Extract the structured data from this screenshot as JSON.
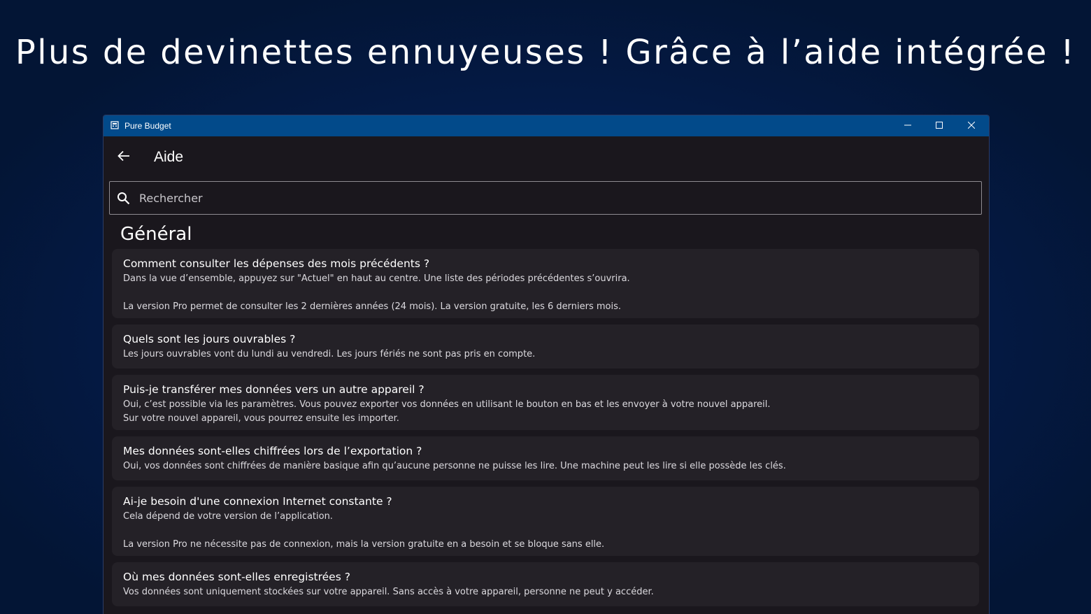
{
  "banner": {
    "headline": "Plus de devinettes ennuyeuses ! Grâce à l’aide intégrée !"
  },
  "window": {
    "title": "Pure Budget",
    "controls": {
      "minimize": "minimize-icon",
      "maximize": "maximize-icon",
      "close": "close-icon"
    }
  },
  "header": {
    "title": "Aide",
    "back_icon": "back-arrow-icon"
  },
  "search": {
    "placeholder": "Rechercher",
    "value": "",
    "icon": "search-icon"
  },
  "section": {
    "title": "Général"
  },
  "faq": [
    {
      "question": "Comment consulter les dépenses des mois précédents ?",
      "answer": "Dans la vue d’ensemble, appuyez sur \"Actuel\" en haut au centre. Une liste des périodes précédentes s’ouvrira.\n\nLa version Pro permet de consulter les 2 dernières années (24 mois). La version gratuite, les 6 derniers mois."
    },
    {
      "question": "Quels sont les jours ouvrables ?",
      "answer": "Les jours ouvrables vont du lundi au vendredi. Les jours fériés ne sont pas pris en compte."
    },
    {
      "question": "Puis-je transférer mes données vers un autre appareil ?",
      "answer": "Oui, c’est possible via les paramètres. Vous pouvez exporter vos données en utilisant le bouton en bas et les envoyer à votre nouvel appareil.\nSur votre nouvel appareil, vous pourrez ensuite les importer."
    },
    {
      "question": "Mes données sont-elles chiffrées lors de l’exportation ?",
      "answer": "Oui, vos données sont chiffrées de manière basique afin qu’aucune personne ne puisse les lire. Une machine peut les lire si elle possède les clés."
    },
    {
      "question": "Ai-je besoin d'une connexion Internet constante ?",
      "answer": "Cela dépend de votre version de l’application.\n\nLa version Pro ne nécessite pas de connexion, mais la version gratuite en a besoin et se bloque sans elle."
    },
    {
      "question": "Où mes données sont-elles enregistrées ?",
      "answer": "Vos données sont uniquement stockées sur votre appareil. Sans accès à votre appareil, personne ne peut y accéder."
    }
  ]
}
